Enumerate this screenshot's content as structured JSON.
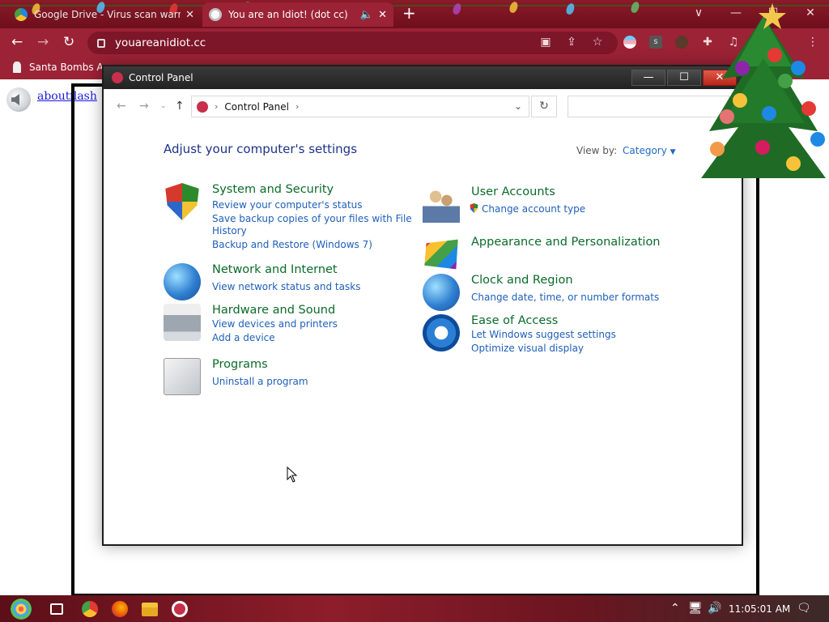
{
  "browser": {
    "tabs": [
      {
        "title": "Google Drive - Virus scan warni",
        "active": false
      },
      {
        "title": "You are an Idiot! (dot cc)",
        "active": true
      }
    ],
    "url": "youareanidiot.cc",
    "bookmark": "Santa Bombs Ara",
    "window_controls": [
      "∨",
      "—",
      "☐",
      "✕"
    ]
  },
  "page": {
    "links": [
      "about",
      "flash"
    ]
  },
  "control_panel": {
    "title": "Control Panel",
    "breadcrumb": "Control Panel",
    "heading": "Adjust your computer's settings",
    "view_by_label": "View by:",
    "view_by_value": "Category",
    "categories_left": [
      {
        "title": "System and Security",
        "icon": "shield-icon",
        "links": [
          "Review your computer's status",
          "Save backup copies of your files with File",
          "History",
          "Backup and Restore (Windows 7)"
        ]
      },
      {
        "title": "Network and Internet",
        "icon": "network-icon",
        "links": [
          "View network status and tasks"
        ]
      },
      {
        "title": "Hardware and Sound",
        "icon": "printer-icon",
        "links": [
          "View devices and printers",
          "Add a device"
        ]
      },
      {
        "title": "Programs",
        "icon": "programs-icon",
        "links": [
          "Uninstall a program"
        ]
      }
    ],
    "categories_right": [
      {
        "title": "User Accounts",
        "icon": "users-icon",
        "links": [
          "Change account type"
        ]
      },
      {
        "title": "Appearance and Personalization",
        "icon": "appearance-icon",
        "links": []
      },
      {
        "title": "Clock and Region",
        "icon": "clock-globe-icon",
        "links": [
          "Change date, time, or number formats"
        ]
      },
      {
        "title": "Ease of Access",
        "icon": "ease-of-access-icon",
        "links": [
          "Let Windows suggest settings",
          "Optimize visual display"
        ]
      }
    ]
  },
  "taskbar": {
    "clock": "11:05:01 AM"
  }
}
